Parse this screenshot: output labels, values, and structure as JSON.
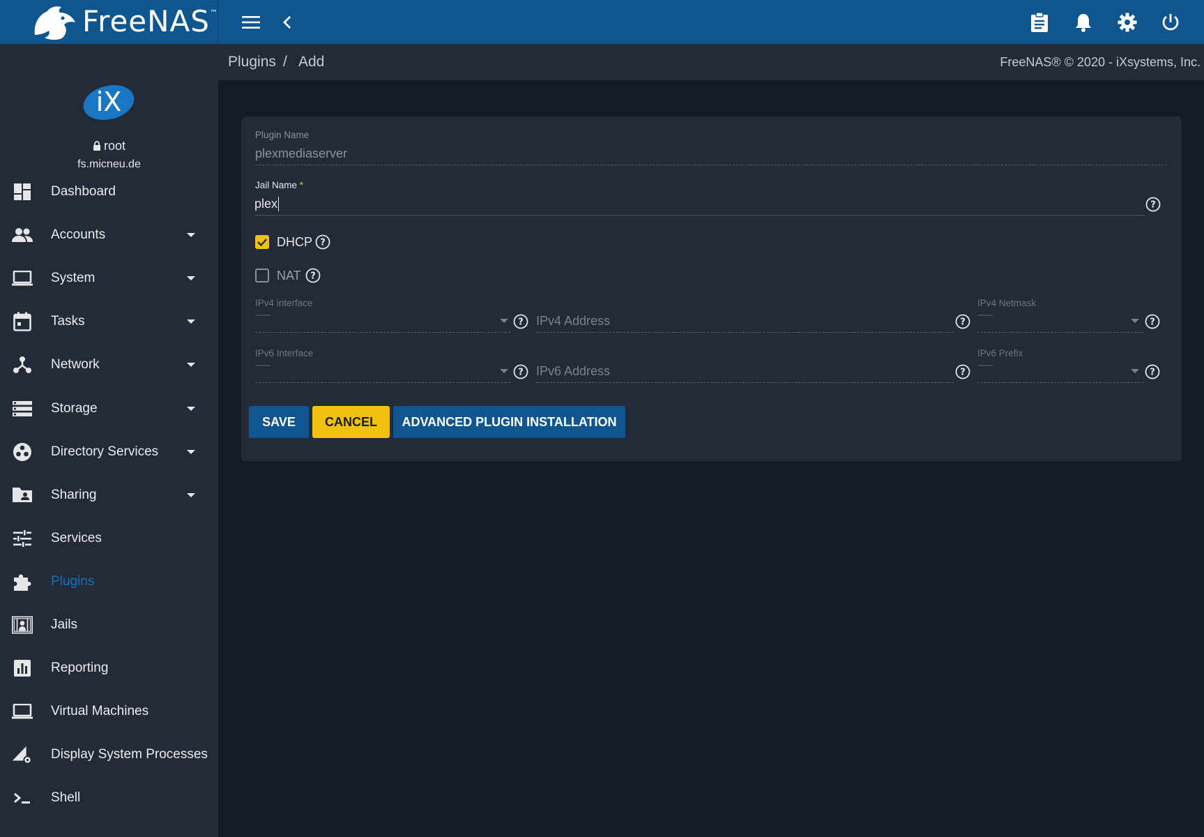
{
  "app": {
    "brand_name": "FreeNAS",
    "brand_tm": "™",
    "colors": {
      "topbar": "#0f5690",
      "sidebar": "#232b38",
      "content": "#151b25",
      "accent_yellow": "#f0c20f",
      "accent_blue": "#0f74c0"
    }
  },
  "topbar": {
    "icons": [
      "menu-icon",
      "chevron-left-icon",
      "clipboard-icon",
      "bell-icon",
      "gear-icon",
      "power-icon"
    ]
  },
  "profile": {
    "logo_text": "iX",
    "username": "root",
    "hostname": "fs.micneu.de"
  },
  "sidebar": {
    "items": [
      {
        "label": "Dashboard",
        "icon": "dashboard-icon",
        "expandable": false
      },
      {
        "label": "Accounts",
        "icon": "people-icon",
        "expandable": true
      },
      {
        "label": "System",
        "icon": "laptop-icon",
        "expandable": true
      },
      {
        "label": "Tasks",
        "icon": "calendar-icon",
        "expandable": true
      },
      {
        "label": "Network",
        "icon": "network-icon",
        "expandable": true
      },
      {
        "label": "Storage",
        "icon": "storage-icon",
        "expandable": true
      },
      {
        "label": "Directory Services",
        "icon": "directory-icon",
        "expandable": true
      },
      {
        "label": "Sharing",
        "icon": "folder-shared-icon",
        "expandable": true
      },
      {
        "label": "Services",
        "icon": "tune-icon",
        "expandable": false
      },
      {
        "label": "Plugins",
        "icon": "puzzle-icon",
        "expandable": false,
        "active": true
      },
      {
        "label": "Jails",
        "icon": "jail-icon",
        "expandable": false
      },
      {
        "label": "Reporting",
        "icon": "chart-icon",
        "expandable": false
      },
      {
        "label": "Virtual Machines",
        "icon": "computer-icon",
        "expandable": false
      },
      {
        "label": "Display System Processes",
        "icon": "processes-icon",
        "expandable": false
      },
      {
        "label": "Shell",
        "icon": "terminal-icon",
        "expandable": false
      }
    ]
  },
  "breadcrumb": {
    "part1": "Plugins",
    "separator": "/",
    "part2": "Add"
  },
  "copyright": "FreeNAS® © 2020 - iXsystems, Inc.",
  "form": {
    "plugin_name": {
      "label": "Plugin Name",
      "value": "plexmediaserver"
    },
    "jail_name": {
      "label": "Jail Name",
      "required_mark": "*",
      "value": "plex"
    },
    "dhcp": {
      "label": "DHCP",
      "checked": true
    },
    "nat": {
      "label": "NAT",
      "checked": false
    },
    "ipv4_interface": {
      "label": "IPv4 interface",
      "value": "--------"
    },
    "ipv4_address": {
      "placeholder": "IPv4 Address"
    },
    "ipv4_netmask": {
      "label": "IPv4 Netmask",
      "value": "--------"
    },
    "ipv6_interface": {
      "label": "IPv6 Interface",
      "value": "--------"
    },
    "ipv6_address": {
      "placeholder": "IPv6 Address"
    },
    "ipv6_prefix": {
      "label": "IPv6 Prefix",
      "value": "--------"
    }
  },
  "buttons": {
    "save": "SAVE",
    "cancel": "CANCEL",
    "advanced": "ADVANCED PLUGIN INSTALLATION"
  }
}
